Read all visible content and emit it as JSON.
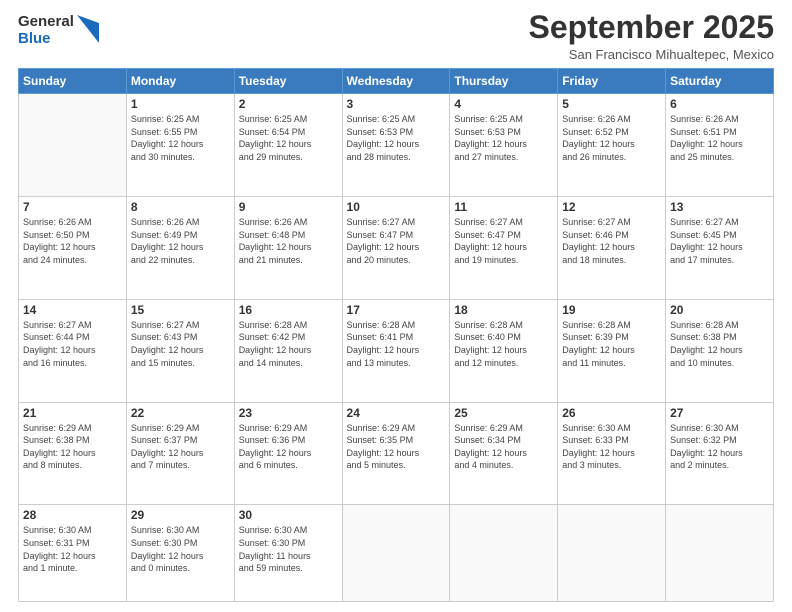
{
  "header": {
    "logo_general": "General",
    "logo_blue": "Blue",
    "month_title": "September 2025",
    "location": "San Francisco Mihualtepec, Mexico"
  },
  "days_of_week": [
    "Sunday",
    "Monday",
    "Tuesday",
    "Wednesday",
    "Thursday",
    "Friday",
    "Saturday"
  ],
  "weeks": [
    [
      {
        "day": "",
        "info": ""
      },
      {
        "day": "1",
        "info": "Sunrise: 6:25 AM\nSunset: 6:55 PM\nDaylight: 12 hours\nand 30 minutes."
      },
      {
        "day": "2",
        "info": "Sunrise: 6:25 AM\nSunset: 6:54 PM\nDaylight: 12 hours\nand 29 minutes."
      },
      {
        "day": "3",
        "info": "Sunrise: 6:25 AM\nSunset: 6:53 PM\nDaylight: 12 hours\nand 28 minutes."
      },
      {
        "day": "4",
        "info": "Sunrise: 6:25 AM\nSunset: 6:53 PM\nDaylight: 12 hours\nand 27 minutes."
      },
      {
        "day": "5",
        "info": "Sunrise: 6:26 AM\nSunset: 6:52 PM\nDaylight: 12 hours\nand 26 minutes."
      },
      {
        "day": "6",
        "info": "Sunrise: 6:26 AM\nSunset: 6:51 PM\nDaylight: 12 hours\nand 25 minutes."
      }
    ],
    [
      {
        "day": "7",
        "info": "Sunrise: 6:26 AM\nSunset: 6:50 PM\nDaylight: 12 hours\nand 24 minutes."
      },
      {
        "day": "8",
        "info": "Sunrise: 6:26 AM\nSunset: 6:49 PM\nDaylight: 12 hours\nand 22 minutes."
      },
      {
        "day": "9",
        "info": "Sunrise: 6:26 AM\nSunset: 6:48 PM\nDaylight: 12 hours\nand 21 minutes."
      },
      {
        "day": "10",
        "info": "Sunrise: 6:27 AM\nSunset: 6:47 PM\nDaylight: 12 hours\nand 20 minutes."
      },
      {
        "day": "11",
        "info": "Sunrise: 6:27 AM\nSunset: 6:47 PM\nDaylight: 12 hours\nand 19 minutes."
      },
      {
        "day": "12",
        "info": "Sunrise: 6:27 AM\nSunset: 6:46 PM\nDaylight: 12 hours\nand 18 minutes."
      },
      {
        "day": "13",
        "info": "Sunrise: 6:27 AM\nSunset: 6:45 PM\nDaylight: 12 hours\nand 17 minutes."
      }
    ],
    [
      {
        "day": "14",
        "info": "Sunrise: 6:27 AM\nSunset: 6:44 PM\nDaylight: 12 hours\nand 16 minutes."
      },
      {
        "day": "15",
        "info": "Sunrise: 6:27 AM\nSunset: 6:43 PM\nDaylight: 12 hours\nand 15 minutes."
      },
      {
        "day": "16",
        "info": "Sunrise: 6:28 AM\nSunset: 6:42 PM\nDaylight: 12 hours\nand 14 minutes."
      },
      {
        "day": "17",
        "info": "Sunrise: 6:28 AM\nSunset: 6:41 PM\nDaylight: 12 hours\nand 13 minutes."
      },
      {
        "day": "18",
        "info": "Sunrise: 6:28 AM\nSunset: 6:40 PM\nDaylight: 12 hours\nand 12 minutes."
      },
      {
        "day": "19",
        "info": "Sunrise: 6:28 AM\nSunset: 6:39 PM\nDaylight: 12 hours\nand 11 minutes."
      },
      {
        "day": "20",
        "info": "Sunrise: 6:28 AM\nSunset: 6:38 PM\nDaylight: 12 hours\nand 10 minutes."
      }
    ],
    [
      {
        "day": "21",
        "info": "Sunrise: 6:29 AM\nSunset: 6:38 PM\nDaylight: 12 hours\nand 8 minutes."
      },
      {
        "day": "22",
        "info": "Sunrise: 6:29 AM\nSunset: 6:37 PM\nDaylight: 12 hours\nand 7 minutes."
      },
      {
        "day": "23",
        "info": "Sunrise: 6:29 AM\nSunset: 6:36 PM\nDaylight: 12 hours\nand 6 minutes."
      },
      {
        "day": "24",
        "info": "Sunrise: 6:29 AM\nSunset: 6:35 PM\nDaylight: 12 hours\nand 5 minutes."
      },
      {
        "day": "25",
        "info": "Sunrise: 6:29 AM\nSunset: 6:34 PM\nDaylight: 12 hours\nand 4 minutes."
      },
      {
        "day": "26",
        "info": "Sunrise: 6:30 AM\nSunset: 6:33 PM\nDaylight: 12 hours\nand 3 minutes."
      },
      {
        "day": "27",
        "info": "Sunrise: 6:30 AM\nSunset: 6:32 PM\nDaylight: 12 hours\nand 2 minutes."
      }
    ],
    [
      {
        "day": "28",
        "info": "Sunrise: 6:30 AM\nSunset: 6:31 PM\nDaylight: 12 hours\nand 1 minute."
      },
      {
        "day": "29",
        "info": "Sunrise: 6:30 AM\nSunset: 6:30 PM\nDaylight: 12 hours\nand 0 minutes."
      },
      {
        "day": "30",
        "info": "Sunrise: 6:30 AM\nSunset: 6:30 PM\nDaylight: 11 hours\nand 59 minutes."
      },
      {
        "day": "",
        "info": ""
      },
      {
        "day": "",
        "info": ""
      },
      {
        "day": "",
        "info": ""
      },
      {
        "day": "",
        "info": ""
      }
    ]
  ]
}
